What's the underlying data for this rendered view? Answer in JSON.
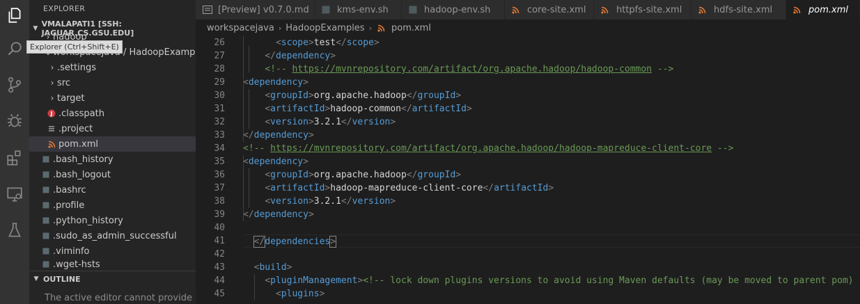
{
  "sidebar": {
    "title": "EXPLORER",
    "tooltip": "Explorer (Ctrl+Shift+E)",
    "workspace": "VMALAPATI1 [SSH: JAGUAR.CS.GSU.EDU]",
    "tree": [
      {
        "label": "hadoop"
      },
      {
        "label": "workspacejava / HadoopExamples"
      },
      {
        "label": ".settings"
      },
      {
        "label": "src"
      },
      {
        "label": "target"
      },
      {
        "label": ".classpath"
      },
      {
        "label": ".project"
      },
      {
        "label": "pom.xml"
      },
      {
        "label": ".bash_history"
      },
      {
        "label": ".bash_logout"
      },
      {
        "label": ".bashrc"
      },
      {
        "label": ".profile"
      },
      {
        "label": ".python_history"
      },
      {
        "label": ".sudo_as_admin_successful"
      },
      {
        "label": ".viminfo"
      },
      {
        "label": ".wget-hsts"
      }
    ],
    "outline_title": "OUTLINE",
    "outline_message": "The active editor cannot provide"
  },
  "tabs": [
    {
      "label": "[Preview] v0.7.0.md"
    },
    {
      "label": "kms-env.sh"
    },
    {
      "label": "hadoop-env.sh"
    },
    {
      "label": "core-site.xml"
    },
    {
      "label": "httpfs-site.xml"
    },
    {
      "label": "hdfs-site.xml"
    },
    {
      "label": "pom.xml"
    }
  ],
  "breadcrumb": [
    "workspacejava",
    "HadoopExamples",
    "pom.xml"
  ],
  "editor": {
    "lines": [
      {
        "n": "26",
        "t": "      <scope>test</scope>"
      },
      {
        "n": "27",
        "t": "    </dependency>"
      },
      {
        "n": "28",
        "t": "    <!-- https://mvnrepository.com/artifact/org.apache.hadoop/hadoop-common -->"
      },
      {
        "n": "29",
        "t": "<dependency>"
      },
      {
        "n": "30",
        "t": "    <groupId>org.apache.hadoop</groupId>"
      },
      {
        "n": "31",
        "t": "    <artifactId>hadoop-common</artifactId>"
      },
      {
        "n": "32",
        "t": "    <version>3.2.1</version>"
      },
      {
        "n": "33",
        "t": "</dependency>"
      },
      {
        "n": "34",
        "t": "<!-- https://mvnrepository.com/artifact/org.apache.hadoop/hadoop-mapreduce-client-core -->"
      },
      {
        "n": "35",
        "t": "<dependency>"
      },
      {
        "n": "36",
        "t": "    <groupId>org.apache.hadoop</groupId>"
      },
      {
        "n": "37",
        "t": "    <artifactId>hadoop-mapreduce-client-core</artifactId>"
      },
      {
        "n": "38",
        "t": "    <version>3.2.1</version>"
      },
      {
        "n": "39",
        "t": "</dependency>"
      },
      {
        "n": "40",
        "t": ""
      },
      {
        "n": "41",
        "t": "  </dependencies>"
      },
      {
        "n": "42",
        "t": ""
      },
      {
        "n": "43",
        "t": "  <build>"
      },
      {
        "n": "44",
        "t": "    <pluginManagement><!-- lock down plugins versions to avoid using Maven defaults (may be moved to parent pom) -"
      },
      {
        "n": "45",
        "t": "      <plugins>"
      }
    ]
  },
  "colors": {
    "activitybar": "#333333",
    "sidebar": "#252526",
    "editor_bg": "#1e1e1e",
    "tag": "#569cd6",
    "comment": "#6a9955",
    "xml_icon": "#e37933",
    "java_icon": "#cc3e44"
  }
}
